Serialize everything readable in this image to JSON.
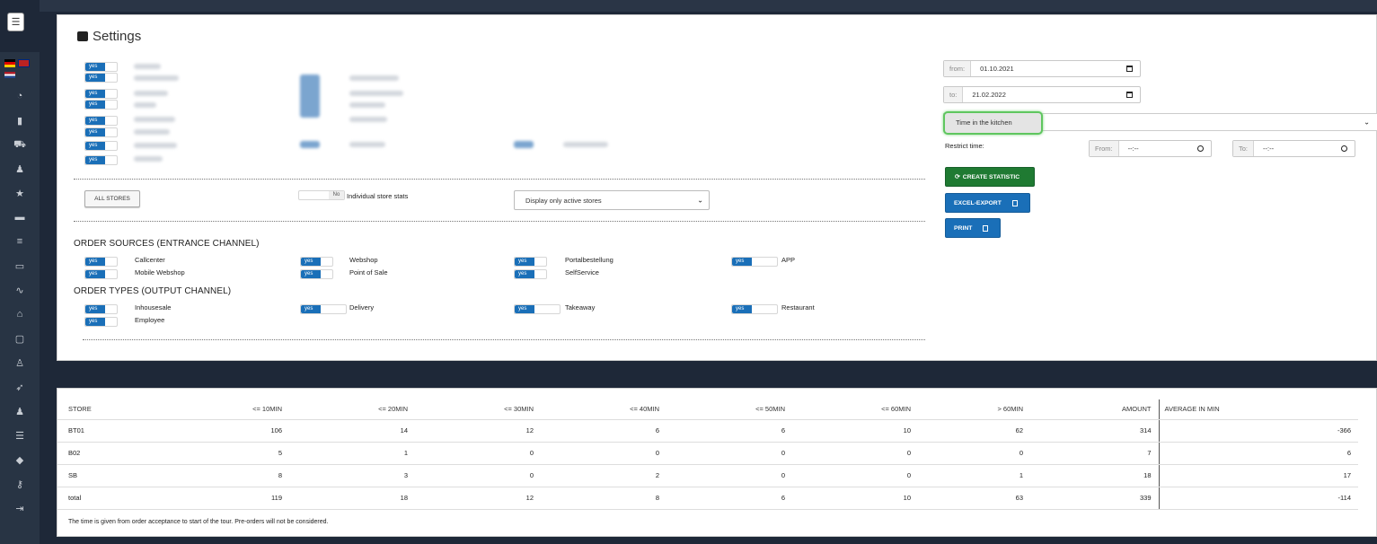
{
  "settings": {
    "title": "Settings",
    "all_stores_button": "ALL STORES",
    "individual_toggle": "No",
    "individual_label": "Individual store stats",
    "store_filter_value": "Display only active stores",
    "order_sources_title": "ORDER SOURCES (ENTRANCE CHANNEL)",
    "order_sources": [
      "Callcenter",
      "Webshop",
      "Portalbestellung",
      "APP",
      "Mobile Webshop",
      "Point of Sale",
      "SelfService"
    ],
    "order_types_title": "ORDER TYPES (OUTPUT CHANNEL)",
    "order_types": [
      "Inhousesale",
      "Delivery",
      "Takeaway",
      "Restaurant",
      "Employee"
    ],
    "toggle_yes": "yes"
  },
  "filters": {
    "from_label": "from:",
    "from_value": "01.10.2021",
    "to_label": "to:",
    "to_value": "21.02.2022",
    "statistic_type": "Time in the kitchen",
    "restrict_time_label": "Restrict time:",
    "restrict_from_label": "From:",
    "restrict_from_value": "--:--",
    "restrict_to_label": "To:",
    "restrict_to_value": "--:--",
    "create_button": "CREATE STATISTIC",
    "excel_button": "EXCEL-EXPORT",
    "print_button": "PRINT"
  },
  "table": {
    "headers": [
      "STORE",
      "<= 10MIN",
      "<= 20MIN",
      "<= 30MIN",
      "<= 40MIN",
      "<= 50MIN",
      "<= 60MIN",
      "> 60MIN",
      "AMOUNT",
      "AVERAGE IN MIN"
    ],
    "rows": [
      [
        "BT01",
        "106",
        "14",
        "12",
        "6",
        "6",
        "10",
        "62",
        "314",
        "-366"
      ],
      [
        "B02",
        "5",
        "1",
        "0",
        "0",
        "0",
        "0",
        "0",
        "7",
        "6"
      ],
      [
        "SB",
        "8",
        "3",
        "0",
        "2",
        "0",
        "0",
        "1",
        "18",
        "17"
      ],
      [
        "total",
        "119",
        "18",
        "12",
        "8",
        "6",
        "10",
        "63",
        "339",
        "-114"
      ]
    ],
    "note": "The time is given from order acceptance to start of the tour. Pre-orders will not be considered."
  },
  "icons": {
    "menu": "hamburger-icon",
    "sidebar": [
      "dashboard-icon",
      "chart-icon",
      "cart-icon",
      "user-add-icon",
      "star-icon",
      "archive-icon",
      "list-icon",
      "book-icon",
      "trend-icon",
      "home-icon",
      "monitor-icon",
      "user-icon",
      "rocket-icon",
      "users-icon",
      "database-icon",
      "box-icon",
      "key-icon",
      "logout-icon"
    ]
  },
  "colors": {
    "sidebar_bg": "#283444",
    "toggle_blue": "#1a6fb8",
    "create_green": "#1f7a32",
    "highlight_green": "#5fc65f"
  }
}
